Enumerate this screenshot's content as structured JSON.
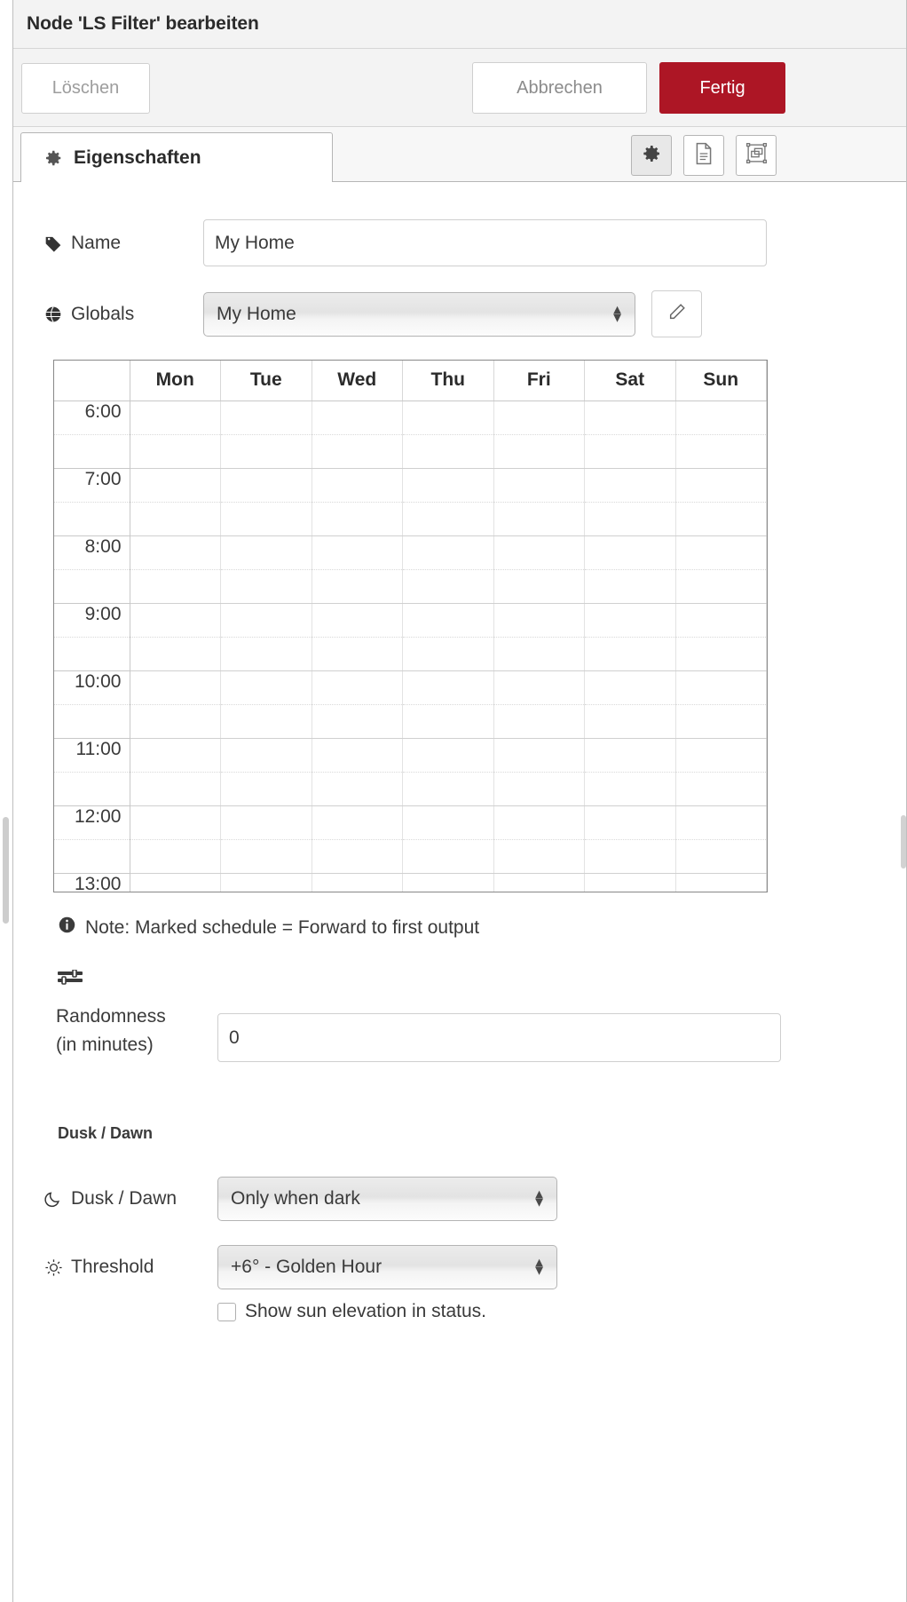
{
  "window": {
    "title": "Node 'LS Filter' bearbeiten"
  },
  "actions": {
    "delete_label": "Löschen",
    "cancel_label": "Abbrechen",
    "done_label": "Fertig",
    "done_color": "#ad1625"
  },
  "tabs": [
    {
      "label": "Eigenschaften",
      "icon": "gear-icon",
      "active": true
    }
  ],
  "tool_buttons": [
    {
      "name": "properties-view",
      "icon": "gear-icon",
      "active": true
    },
    {
      "name": "description-view",
      "icon": "document-icon",
      "active": false
    },
    {
      "name": "appearance-view",
      "icon": "appearance-icon",
      "active": false
    }
  ],
  "fields": {
    "name": {
      "label": "Name",
      "icon": "tag-icon",
      "value": "My Home",
      "placeholder": "Name"
    },
    "globals": {
      "label": "Globals",
      "icon": "globe-icon",
      "value": "My Home",
      "edit_icon": "pencil-icon"
    },
    "randomness": {
      "icon": "sliders-icon",
      "label_line1": "Randomness",
      "label_line2": "(in minutes)",
      "value": "0",
      "placeholder": "0"
    }
  },
  "schedule": {
    "days": [
      "Mon",
      "Tue",
      "Wed",
      "Thu",
      "Fri",
      "Sat",
      "Sun"
    ],
    "hours": [
      "6:00",
      "7:00",
      "8:00",
      "9:00",
      "10:00",
      "11:00",
      "12:00",
      "13:00"
    ],
    "marked_cells": []
  },
  "note": {
    "icon": "info-icon",
    "text": "Note: Marked schedule = Forward to first output"
  },
  "dusk_dawn": {
    "heading": "Dusk / Dawn",
    "mode": {
      "label": "Dusk / Dawn",
      "icon": "moon-icon",
      "value": "Only when dark"
    },
    "threshold": {
      "label": "Threshold",
      "icon": "sun-icon",
      "value": "+6° - Golden Hour"
    },
    "show_elevation": {
      "label": "Show sun elevation in status.",
      "checked": false
    }
  }
}
